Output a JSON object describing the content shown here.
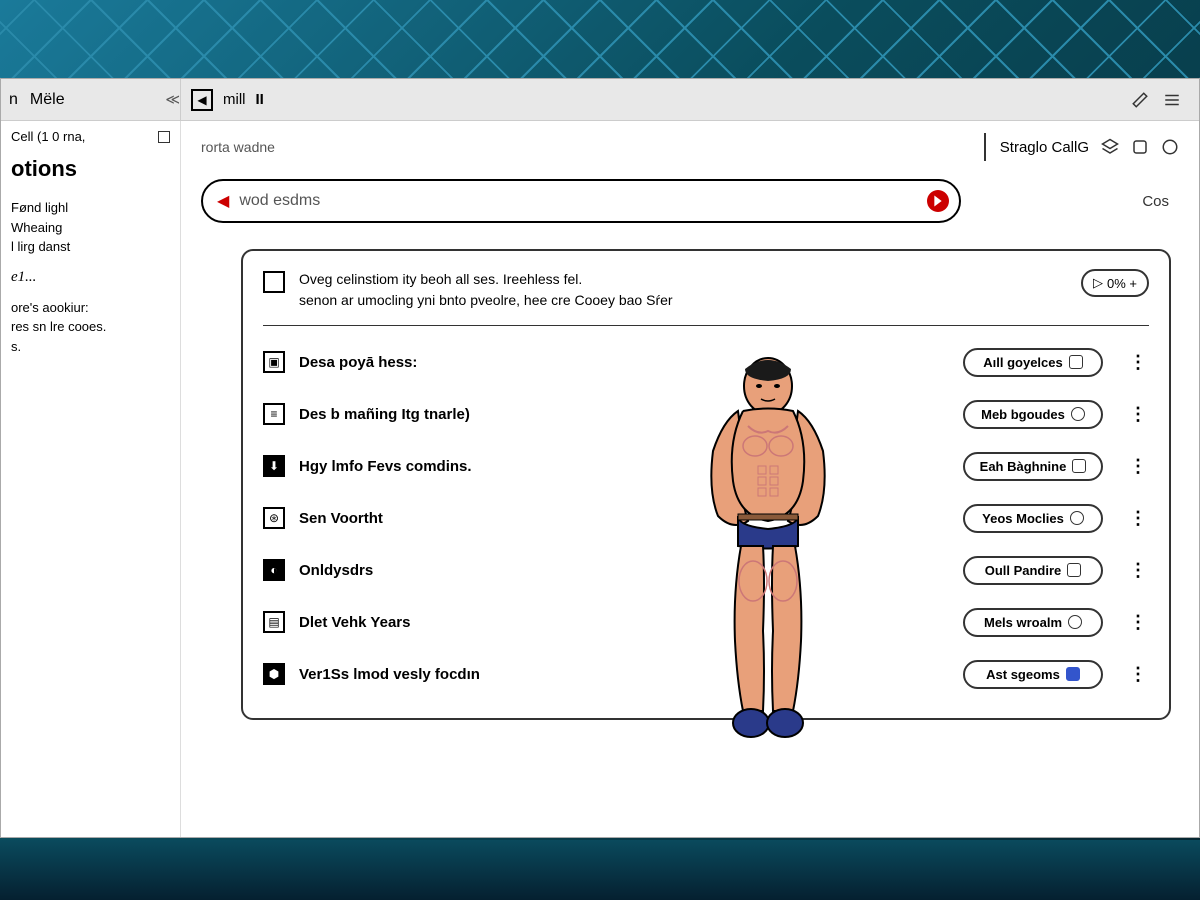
{
  "titlebar": {
    "left_label": "Mële",
    "center_nav": "mill",
    "center_badge": "II"
  },
  "sidebar": {
    "subline": "Cell (1 0 rna,",
    "heading": "otions",
    "para1_line1": "Fønd lighl",
    "para1_line2": "Wheaing",
    "para1_line3": "l lirg danst",
    "italic": "e1...",
    "para2_line1": "ore's aookiur:",
    "para2_line2": "res sn lre cooes.",
    "para2_line3": "s."
  },
  "main": {
    "breadcrumb": "rorta wadne",
    "tool_label": "Straglo CallG",
    "side_link": "Cos"
  },
  "search": {
    "value": "wod esdms"
  },
  "card": {
    "header_line1": "Oveg celinstiom ity beoh all ses. Ireehless fel.",
    "header_line2": "senon ar umocling yni bnto pveolre, hee cre Cooey bao Sŕer",
    "header_badge": "0% +"
  },
  "list": [
    {
      "icon": "camera",
      "label": "Desa poyā hess:",
      "btn": "Aıll goyelces",
      "more": true
    },
    {
      "icon": "list",
      "label": "Des b mañing Itg tnarle)",
      "btn": "Meb bgoudes",
      "more": true
    },
    {
      "icon": "download",
      "label": "Hgy lmfo Fevs comdins.",
      "btn": "Eah Bàghnine",
      "more": true
    },
    {
      "icon": "globe",
      "label": "Sen Voortht",
      "btn": "Yeos Moclies",
      "more": true
    },
    {
      "icon": "moon",
      "label": "Onldysdrs",
      "btn": "Oull Pandire",
      "more": true
    },
    {
      "icon": "lines",
      "label": "Dlet Vehk Years",
      "btn": "Mels wroalm",
      "more": true
    },
    {
      "icon": "shield",
      "label": "Ver1Ss lmod vesly focdın",
      "btn": "Ast sgeoms",
      "more": true
    }
  ]
}
